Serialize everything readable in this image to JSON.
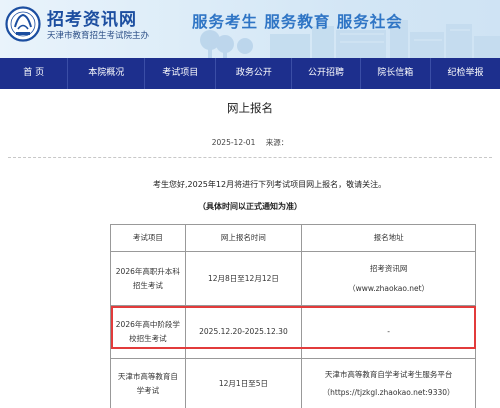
{
  "header": {
    "site_name": "招考资讯网",
    "site_subtitle": "天津市教育招生考试院主办",
    "slogan": "服务考生  服务教育  服务社会",
    "logo_icon": "tjea-seal-logo"
  },
  "nav": {
    "items": [
      {
        "label": "首    页"
      },
      {
        "label": "本院概况"
      },
      {
        "label": "考试项目"
      },
      {
        "label": "政务公开"
      },
      {
        "label": "公开招聘"
      },
      {
        "label": "院长信箱"
      },
      {
        "label": "纪检举报"
      }
    ]
  },
  "article": {
    "title": "网上报名",
    "date": "2025-12-01",
    "source_label": "来源：",
    "intro": "考生您好,2025年12月将进行下列考试项目网上报名，敬请关注。",
    "note": "（具体时间以正式通知为准）"
  },
  "table": {
    "headers": [
      "考试项目",
      "网上报名时间",
      "报名地址"
    ],
    "rows": [
      {
        "project": [
          "2026年高职升本科",
          "招生考试"
        ],
        "time": "12月8日至12月12日",
        "address": [
          "招考资讯网",
          "（www.zhaokao.net）"
        ]
      },
      {
        "project": [
          "2026年高中阶段学",
          "校招生考试"
        ],
        "time": "2025.12.20-2025.12.30",
        "address": [
          "-"
        ]
      },
      {
        "project": [
          "天津市高等教育自",
          "学考试"
        ],
        "time": "12月1日至5日",
        "address": [
          "天津市高等教育自学考试考生服务平台",
          "（https://tjzkgl.zhaokao.net:9330）"
        ]
      }
    ]
  },
  "colors": {
    "nav_bg": "#1d2f8d",
    "brand_blue": "#1c4ea0",
    "slogan_blue": "#2f75c5",
    "highlight_red": "#e23b3b"
  }
}
